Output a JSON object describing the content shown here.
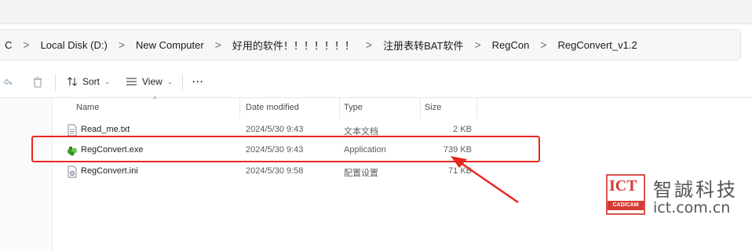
{
  "breadcrumb": [
    "C",
    "Local Disk (D:)",
    "New Computer",
    "好用的软件！！！！！！！",
    "注册表转BAT软件",
    "RegCon",
    "RegConvert_v1.2"
  ],
  "breadcrumb_separator": ">",
  "toolbar": {
    "sort_label": "Sort",
    "view_label": "View",
    "more_label": "···"
  },
  "columns": {
    "name": "Name",
    "date": "Date modified",
    "type": "Type",
    "size": "Size"
  },
  "files": [
    {
      "name": "Read_me.txt",
      "date": "2024/5/30 9:43",
      "type": "文本文档",
      "size": "2 KB",
      "icon": "text-file-icon"
    },
    {
      "name": "RegConvert.exe",
      "date": "2024/5/30 9:43",
      "type": "Application",
      "size": "739 KB",
      "icon": "app-exe-icon"
    },
    {
      "name": "RegConvert.ini",
      "date": "2024/5/30 9:58",
      "type": "配置设置",
      "size": "71 KB",
      "icon": "config-file-icon"
    }
  ],
  "watermark": {
    "logo_text": "ICT",
    "logo_sub": "CAD/CAM",
    "chinese_name": "智誠科技",
    "domain": "ict.com.cn"
  },
  "colors": {
    "highlight": "#e8281f",
    "logo_red": "#d63a34"
  }
}
